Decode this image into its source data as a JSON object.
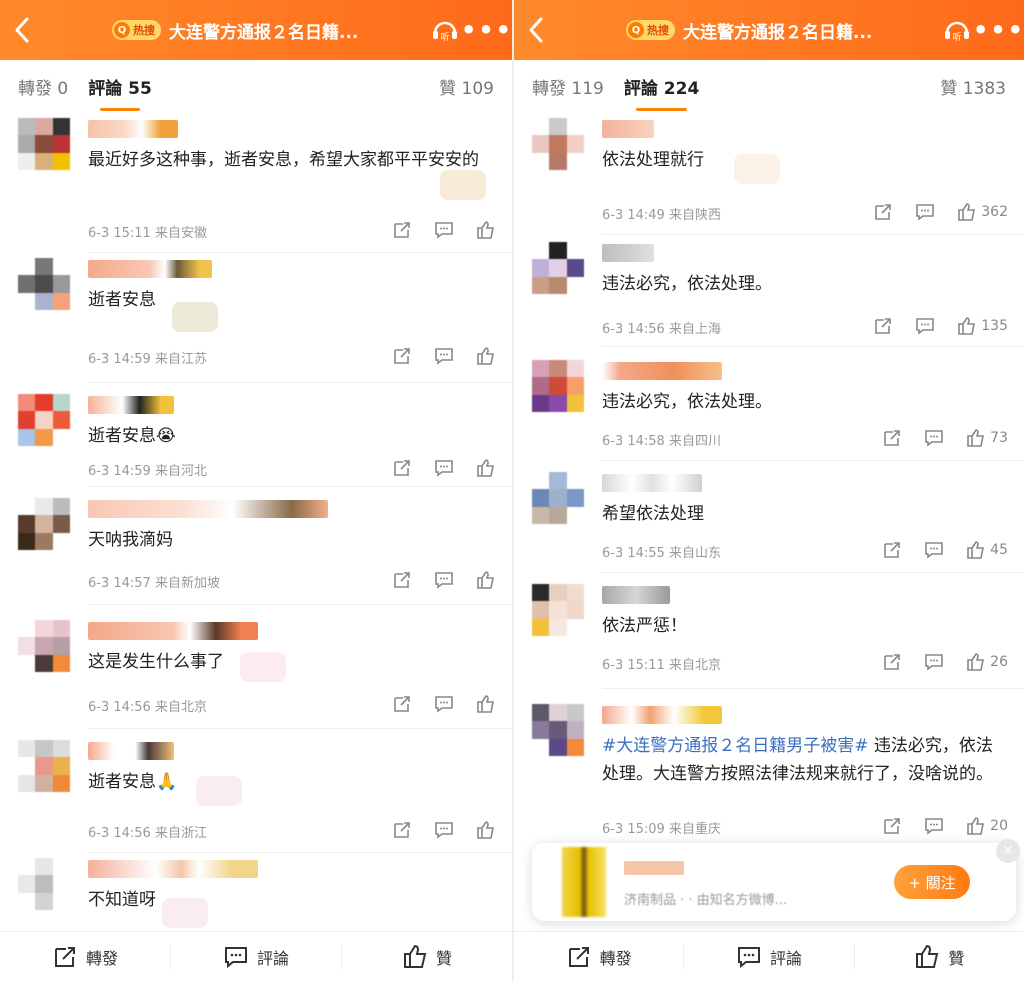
{
  "left": {
    "header": {
      "hot_badge": "热搜",
      "title": "大连警方通报２名日籍...",
      "listen_label": "听"
    },
    "tabs": {
      "reposts": "轉發",
      "reposts_count": "0",
      "comments": "評論",
      "comments_count": "55",
      "likes": "贊",
      "likes_count": "109"
    },
    "comments": [
      {
        "text": "最近好多这种事，逝者安息，希望大家都平平安安的",
        "meta": "6-3 15:11  来自安徽"
      },
      {
        "text": "逝者安息",
        "meta": "6-3 14:59  来自江苏"
      },
      {
        "text": "逝者安息😭",
        "meta": "6-3 14:59  来自河北"
      },
      {
        "text": "天呐我滴妈",
        "meta": "6-3 14:57  来自新加坡"
      },
      {
        "text": "这是发生什么事了",
        "meta": "6-3 14:56  来自北京"
      },
      {
        "text": "逝者安息🙏",
        "meta": "6-3 14:56  来自浙江"
      },
      {
        "text": "不知道呀",
        "meta": ""
      }
    ],
    "bottom": {
      "repost": "轉發",
      "comment": "評論",
      "like": "贊"
    }
  },
  "right": {
    "header": {
      "hot_badge": "热搜",
      "title": "大连警方通报２名日籍...",
      "listen_label": "听"
    },
    "tabs": {
      "reposts": "轉發",
      "reposts_count": "119",
      "comments": "評論",
      "comments_count": "224",
      "likes": "贊",
      "likes_count": "1383"
    },
    "comments": [
      {
        "text": "依法处理就行",
        "meta": "6-3 14:49  来自陕西",
        "likes": "362"
      },
      {
        "text": "违法必究，依法处理。",
        "meta": "6-3 14:56  来自上海",
        "likes": "135"
      },
      {
        "text": "违法必究，依法处理。",
        "meta": "6-3 14:58  来自四川",
        "likes": "73"
      },
      {
        "text": "希望依法处理",
        "meta": "6-3 14:55  来自山东",
        "likes": "45"
      },
      {
        "text": "依法严惩！",
        "meta": "6-3 15:11  来自北京",
        "likes": "26"
      },
      {
        "topic": "#大连警方通报２名日籍男子被害#",
        "text": " 违法必究，依法处理。大连警方按照法律法规来就行了，没啥说的。",
        "meta": "6-3 15:09  来自重庆",
        "likes": "20"
      }
    ],
    "popup": {
      "follow": "+ 關注",
      "desc": "济南制品  ·  ·  由知名方微博..."
    },
    "bottom": {
      "repost": "轉發",
      "comment": "評論",
      "like": "贊"
    }
  },
  "colors": {
    "accent": "#ff7a12",
    "topic": "#3b6fc0"
  },
  "icons": [
    "back-icon",
    "listen-icon",
    "more-icon",
    "repost-icon",
    "comment-icon",
    "like-icon"
  ]
}
